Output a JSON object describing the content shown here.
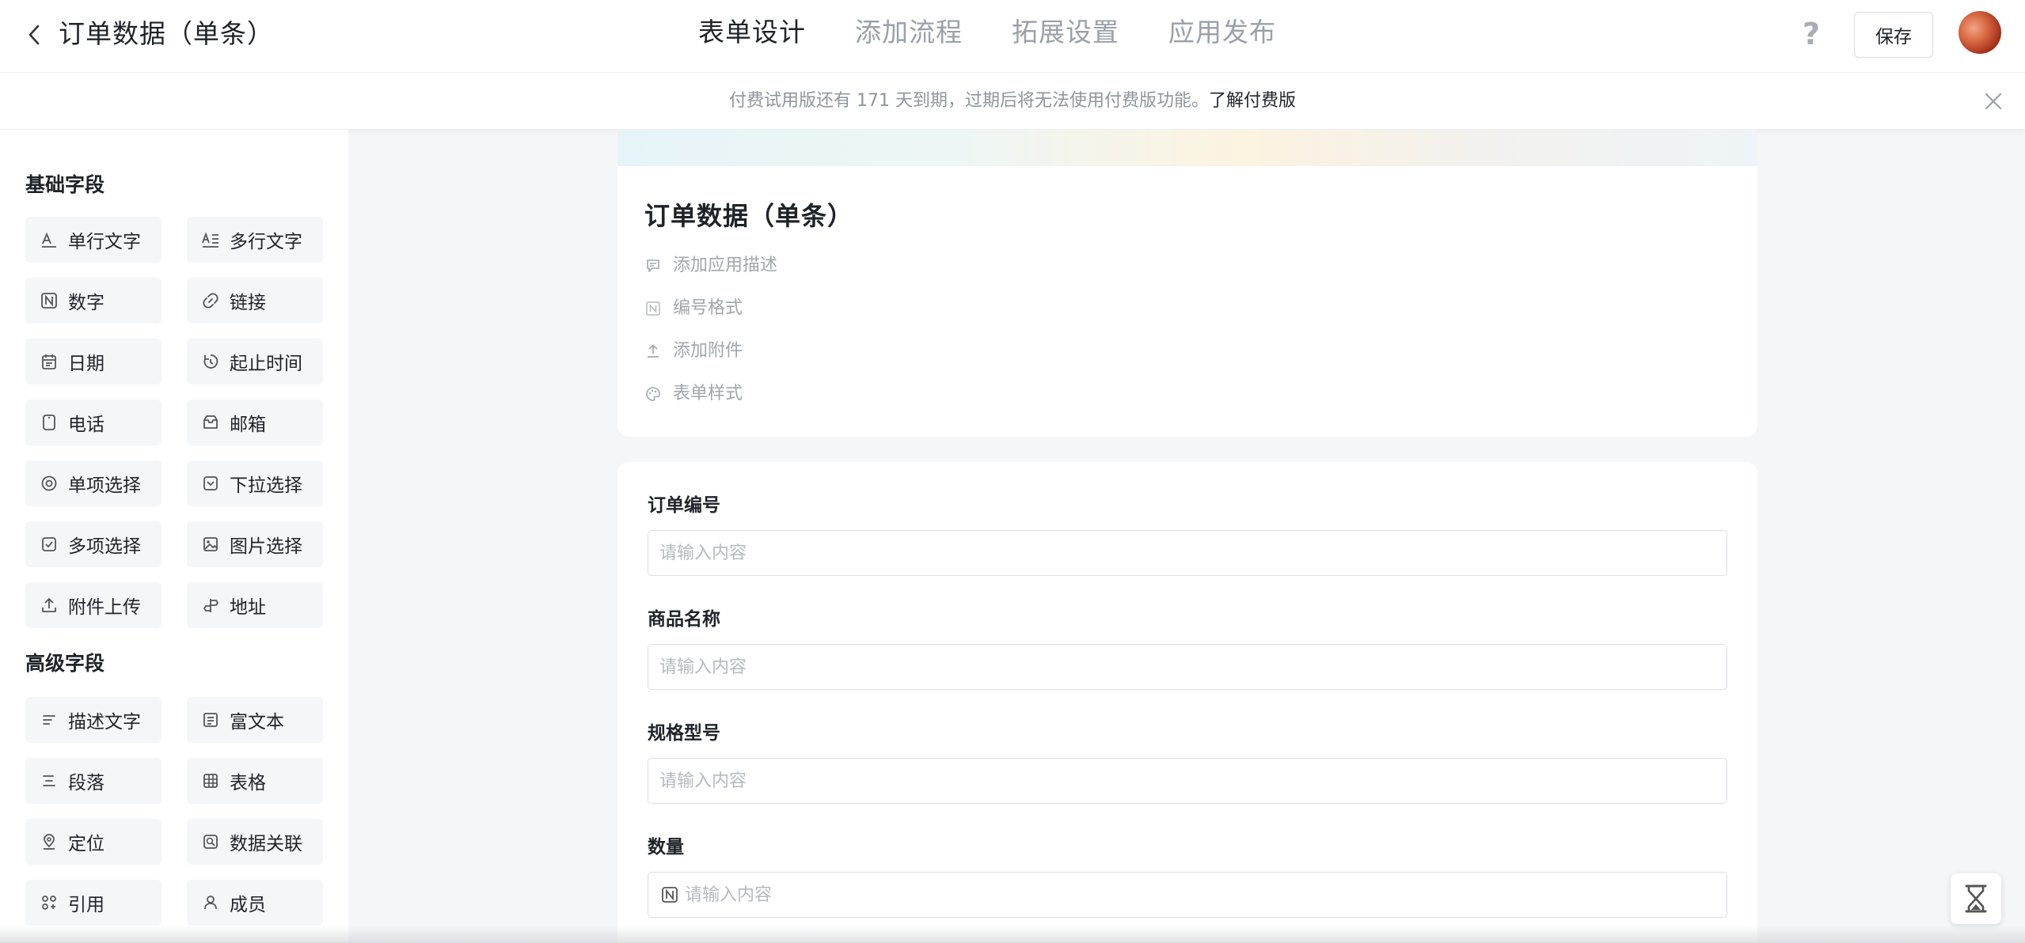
{
  "header": {
    "title": "订单数据（单条）",
    "tabs": [
      {
        "label": "表单设计",
        "active": true
      },
      {
        "label": "添加流程",
        "active": false
      },
      {
        "label": "拓展设置",
        "active": false
      },
      {
        "label": "应用发布",
        "active": false
      }
    ],
    "help_icon": "question-mark-icon",
    "save_label": "保存"
  },
  "notice": {
    "text": "付费试用版还有 171 天到期，过期后将无法使用付费版功能。",
    "link": "了解付费版"
  },
  "sidebar": {
    "basic_title": "基础字段",
    "basic_fields": [
      {
        "label": "单行文字",
        "icon": "single-line-text-icon"
      },
      {
        "label": "多行文字",
        "icon": "multi-line-text-icon"
      },
      {
        "label": "数字",
        "icon": "number-icon"
      },
      {
        "label": "链接",
        "icon": "link-icon"
      },
      {
        "label": "日期",
        "icon": "calendar-icon"
      },
      {
        "label": "起止时间",
        "icon": "time-range-icon"
      },
      {
        "label": "电话",
        "icon": "phone-icon"
      },
      {
        "label": "邮箱",
        "icon": "mail-icon"
      },
      {
        "label": "单项选择",
        "icon": "radio-icon"
      },
      {
        "label": "下拉选择",
        "icon": "dropdown-icon"
      },
      {
        "label": "多项选择",
        "icon": "checkbox-icon"
      },
      {
        "label": "图片选择",
        "icon": "image-icon"
      },
      {
        "label": "附件上传",
        "icon": "upload-icon"
      },
      {
        "label": "地址",
        "icon": "address-icon"
      }
    ],
    "advanced_title": "高级字段",
    "advanced_fields": [
      {
        "label": "描述文字",
        "icon": "description-icon"
      },
      {
        "label": "富文本",
        "icon": "rich-text-icon"
      },
      {
        "label": "段落",
        "icon": "paragraph-icon"
      },
      {
        "label": "表格",
        "icon": "table-icon"
      },
      {
        "label": "定位",
        "icon": "location-icon"
      },
      {
        "label": "数据关联",
        "icon": "data-link-icon"
      },
      {
        "label": "引用",
        "icon": "reference-icon"
      },
      {
        "label": "成员",
        "icon": "member-icon"
      }
    ]
  },
  "form_header": {
    "title": "订单数据（单条）",
    "items": [
      {
        "label": "添加应用描述",
        "icon": "comment-icon"
      },
      {
        "label": "编号格式",
        "icon": "number-format-icon"
      },
      {
        "label": "添加附件",
        "icon": "upload-icon"
      },
      {
        "label": "表单样式",
        "icon": "palette-icon"
      }
    ]
  },
  "form": {
    "fields": [
      {
        "label": "订单编号",
        "placeholder": "请输入内容",
        "value": ""
      },
      {
        "label": "商品名称",
        "placeholder": "请输入内容",
        "value": ""
      },
      {
        "label": "规格型号",
        "placeholder": "请输入内容",
        "value": ""
      },
      {
        "label": "数量",
        "placeholder": "请输入内容",
        "value": ""
      }
    ]
  },
  "float_button_icon": "hourglass-icon",
  "colors": {
    "accent": "#f07f32",
    "text_primary": "#1f2329",
    "text_muted": "#9aa0a8",
    "field_bg": "#f5f6f8"
  }
}
